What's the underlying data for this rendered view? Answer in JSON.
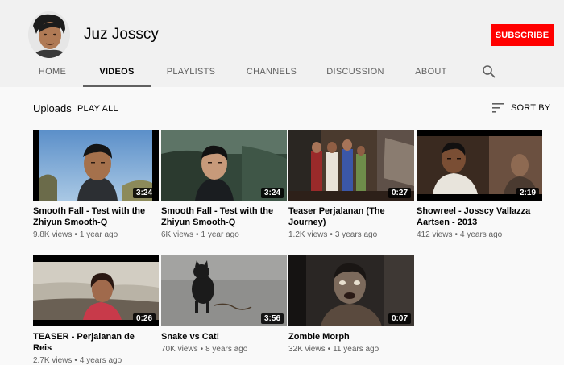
{
  "channel": {
    "name": "Juz Josscy",
    "subscribe_label": "SUBSCRIBE"
  },
  "tabs": [
    {
      "label": "HOME",
      "active": false
    },
    {
      "label": "VIDEOS",
      "active": true
    },
    {
      "label": "PLAYLISTS",
      "active": false
    },
    {
      "label": "CHANNELS",
      "active": false
    },
    {
      "label": "DISCUSSION",
      "active": false
    },
    {
      "label": "ABOUT",
      "active": false
    }
  ],
  "section": {
    "title": "Uploads",
    "play_all": "PLAY ALL",
    "sort_by": "SORT BY"
  },
  "videos": [
    {
      "title": "Smooth Fall - Test with the Zhiyun Smooth-Q",
      "duration": "3:24",
      "views": "9.8K views",
      "age": "1 year ago"
    },
    {
      "title": "Smooth Fall - Test with the Zhiyun Smooth-Q",
      "duration": "3:24",
      "views": "6K views",
      "age": "1 year ago"
    },
    {
      "title": "Teaser Perjalanan (The Journey)",
      "duration": "0:27",
      "views": "1.2K views",
      "age": "3 years ago"
    },
    {
      "title": "Showreel - Josscy Vallazza Aartsen - 2013",
      "duration": "2:19",
      "views": "412 views",
      "age": "4 years ago"
    },
    {
      "title": "TEASER - Perjalanan de Reis",
      "duration": "0:26",
      "views": "2.7K views",
      "age": "4 years ago"
    },
    {
      "title": "Snake vs Cat!",
      "duration": "3:56",
      "views": "70K views",
      "age": "8 years ago"
    },
    {
      "title": "Zombie Morph",
      "duration": "0:07",
      "views": "32K views",
      "age": "11 years ago"
    }
  ],
  "icons": {
    "search": "search-icon",
    "sort": "sort-icon"
  },
  "colors": {
    "subscribe": "#ff0000",
    "header_bg": "#f1f1f1",
    "page_bg": "#f9f9f9"
  }
}
